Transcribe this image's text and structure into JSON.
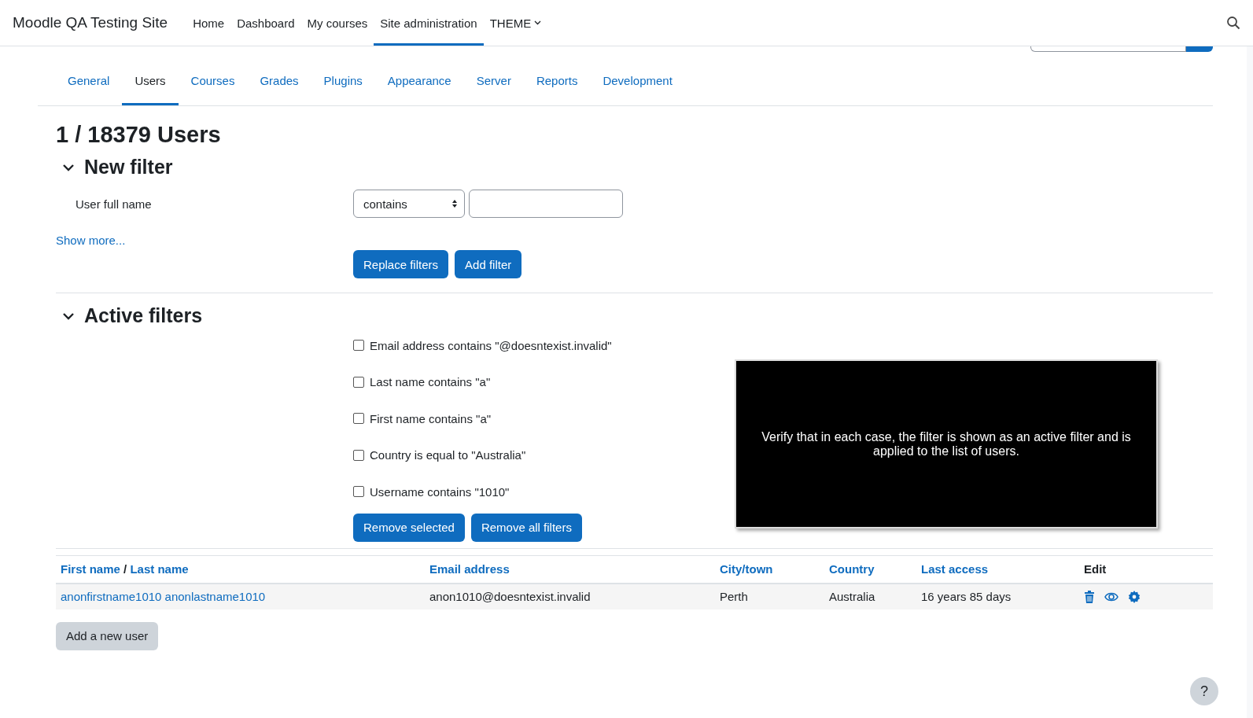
{
  "navbar": {
    "site_name": "Moodle QA Testing Site",
    "items": [
      {
        "label": "Home",
        "selected": false
      },
      {
        "label": "Dashboard",
        "selected": false
      },
      {
        "label": "My courses",
        "selected": false
      },
      {
        "label": "Site administration",
        "selected": true
      },
      {
        "label": "THEME",
        "selected": false,
        "kind": "dropdown"
      }
    ]
  },
  "admin_tabs": [
    {
      "label": "General",
      "selected": false
    },
    {
      "label": "Users",
      "selected": true
    },
    {
      "label": "Courses",
      "selected": false
    },
    {
      "label": "Grades",
      "selected": false
    },
    {
      "label": "Plugins",
      "selected": false
    },
    {
      "label": "Appearance",
      "selected": false
    },
    {
      "label": "Server",
      "selected": false
    },
    {
      "label": "Reports",
      "selected": false
    },
    {
      "label": "Development",
      "selected": false
    }
  ],
  "heading": "1 / 18379 Users",
  "new_filter": {
    "title": "New filter",
    "expanded": true,
    "field_label": "User full name",
    "operator": "contains",
    "show_more": "Show more...",
    "buttons": [
      "Replace filters",
      "Add filter"
    ]
  },
  "active_filters": {
    "title": "Active filters",
    "expanded": true,
    "filters": [
      {
        "label": "Email address contains \"@doesntexist.invalid\"",
        "checked": false
      },
      {
        "label": "Last name contains \"a\"",
        "checked": false
      },
      {
        "label": "First name contains \"a\"",
        "checked": false
      },
      {
        "label": "Country is equal to \"Australia\"",
        "checked": false
      },
      {
        "label": "Username contains \"1010\"",
        "checked": false
      }
    ],
    "buttons": [
      "Remove selected",
      "Remove all filters"
    ]
  },
  "caption_overlay": "Verify that in each case, the filter is shown as an active filter and is applied to the list of users.",
  "table": {
    "columns": [
      {
        "kind": "sortable",
        "parts": [
          "First name",
          "Last name"
        ],
        "separator": "/"
      },
      {
        "kind": "sortable",
        "parts": [
          "Email address"
        ]
      },
      {
        "kind": "sortable",
        "parts": [
          "City/town"
        ]
      },
      {
        "kind": "sortable",
        "parts": [
          "Country"
        ]
      },
      {
        "kind": "sortable",
        "parts": [
          "Last access"
        ]
      },
      {
        "kind": "plain",
        "parts": [
          "Edit"
        ]
      }
    ],
    "rows": [
      {
        "name": "anonfirstname1010 anonlastname1010",
        "email": "anon1010@doesntexist.invalid",
        "city": "Perth",
        "country": "Australia",
        "last_access": "16 years 85 days"
      }
    ]
  },
  "add_user_button": "Add a new user",
  "help_button": "?"
}
